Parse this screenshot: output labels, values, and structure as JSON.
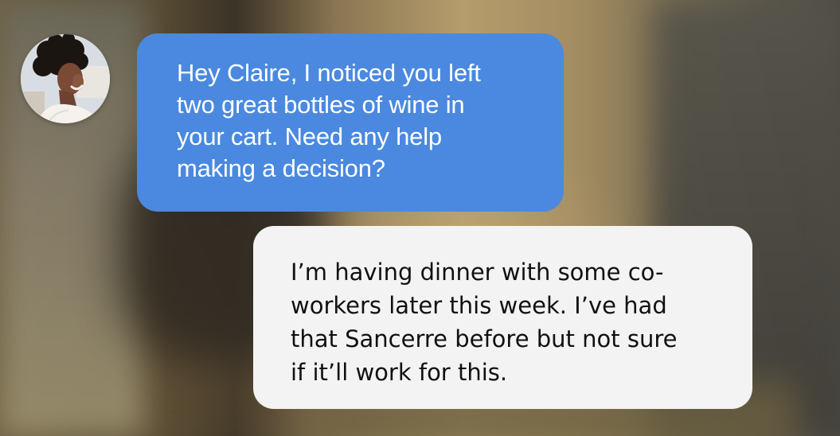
{
  "conversation": {
    "avatar_icon": "woman-profile-avatar",
    "agent_message": {
      "lines": [
        "Hey Claire, I noticed you left",
        "two great bottles of wine in",
        "your cart. Need any help",
        "making a decision?"
      ],
      "bubble_color": "#4a89df",
      "text_color": "#ffffff"
    },
    "user_message": {
      "lines": [
        "I’m having dinner with some co-",
        "workers later this week. I’ve had",
        "that Sancerre before but not sure",
        "if it’ll work for this."
      ],
      "bubble_color": "#f3f3f3",
      "text_color": "#111111"
    }
  }
}
